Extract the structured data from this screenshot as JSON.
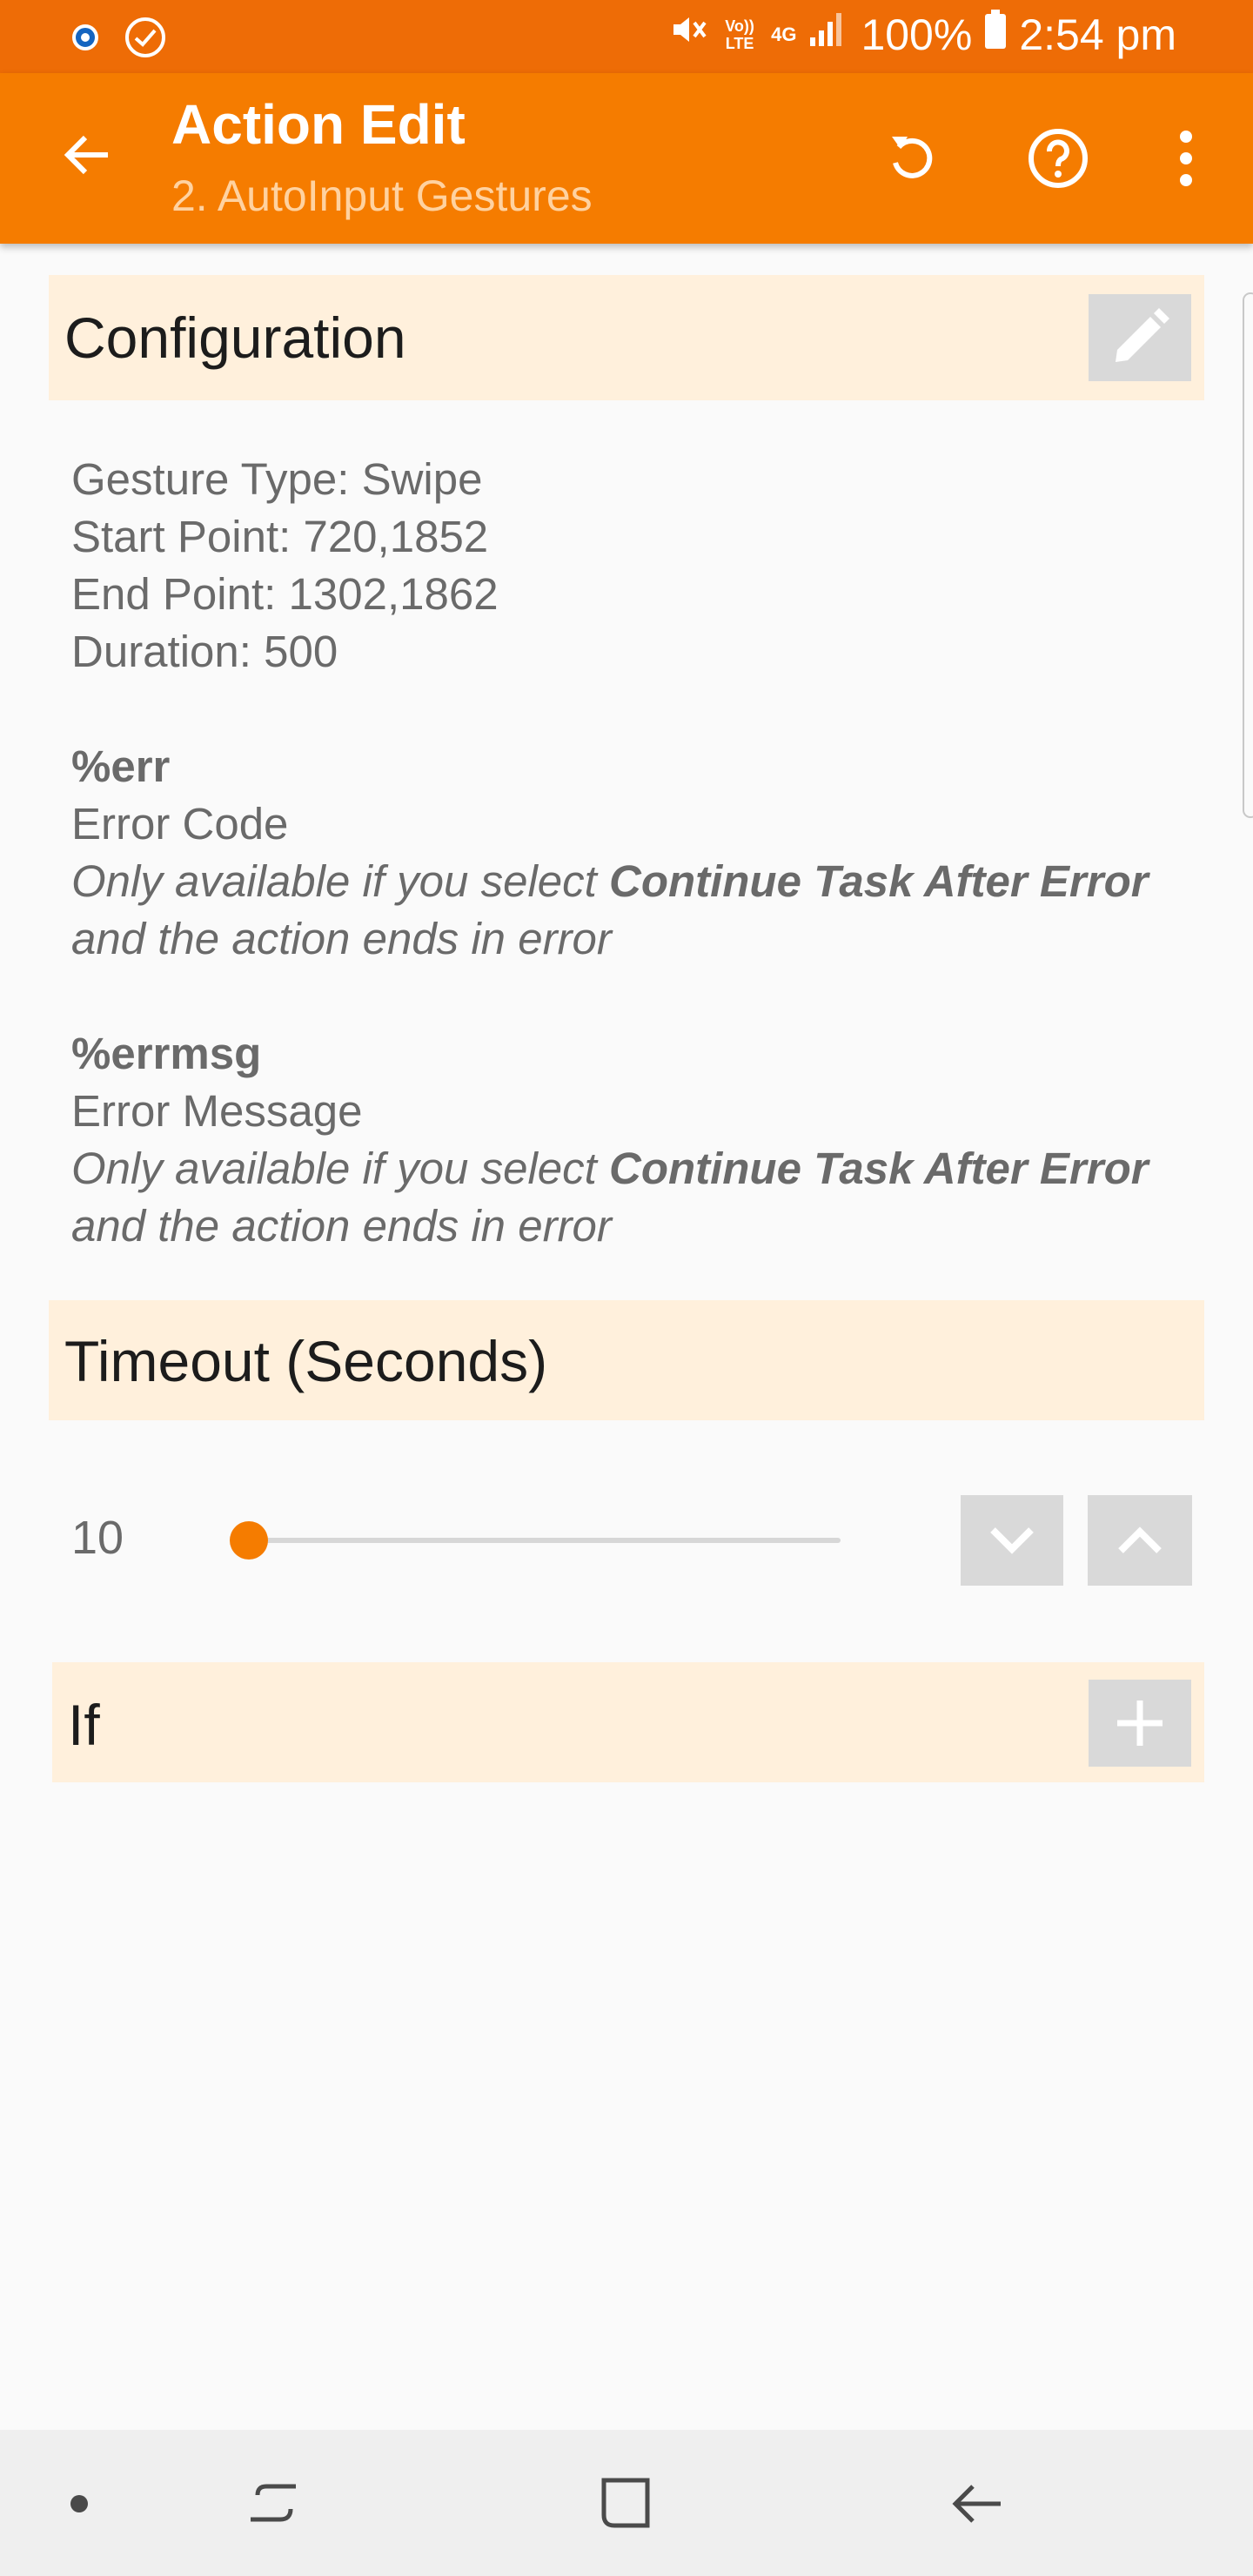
{
  "status_bar": {
    "left_icons": [
      "settings-icon",
      "check-circle-icon"
    ],
    "right_icons": [
      "mute-icon",
      "volte-icon",
      "4g-icon",
      "signal-icon",
      "battery-icon"
    ],
    "volte_label": "Vo)) LTE",
    "network_label": "4G",
    "battery": "100%",
    "time": "2:54 pm"
  },
  "app_bar": {
    "title": "Action Edit",
    "subtitle": "2. AutoInput Gestures",
    "icons": [
      "back-arrow-icon",
      "reset-icon",
      "help-icon",
      "more-vert-icon"
    ]
  },
  "configuration": {
    "title": "Configuration",
    "edit_icon": "pencil-icon",
    "lines": [
      "Gesture Type: Swipe",
      "Start Point: 720,1852",
      "End Point: 1302,1862",
      "Duration: 500"
    ],
    "variables": [
      {
        "name": "%err",
        "label": "Error Code",
        "note_prefix": "Only available if you select ",
        "note_bold": "Continue Task After Error",
        "note_suffix": "and the action ends in error"
      },
      {
        "name": "%errmsg",
        "label": "Error Message",
        "note_prefix": "Only available if you select ",
        "note_bold": "Continue Task After Error",
        "note_suffix": "and the action ends in error"
      }
    ]
  },
  "timeout": {
    "title": "Timeout (Seconds)",
    "value": "10",
    "slider_fraction": 0.0,
    "decrement_icon": "chevron-down-icon",
    "increment_icon": "chevron-up-icon"
  },
  "if_section": {
    "title": "If",
    "add_icon": "plus-icon"
  },
  "nav_bar": {
    "icons": [
      "dot-icon",
      "recents-icon",
      "home-icon",
      "back-icon"
    ]
  },
  "colors": {
    "status_bar": "#ee6c06",
    "app_bar": "#f57c00",
    "section_header": "#fff0dc",
    "accent": "#f57c00"
  }
}
